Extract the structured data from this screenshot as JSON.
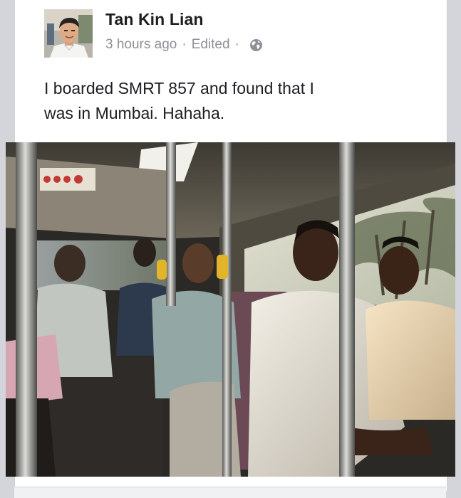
{
  "post": {
    "author": "Tan Kin Lian",
    "time": "3 hours ago",
    "separator": "·",
    "edited": "Edited",
    "privacy_icon": "globe-icon",
    "text_line1": "I boarded SMRT 857 and found that I",
    "text_line2": "was in Mumbai. Hahaha."
  },
  "colors": {
    "name": "#1c1e21",
    "meta": "#8d9096",
    "card": "#ffffff",
    "background": "#d3d5da"
  }
}
